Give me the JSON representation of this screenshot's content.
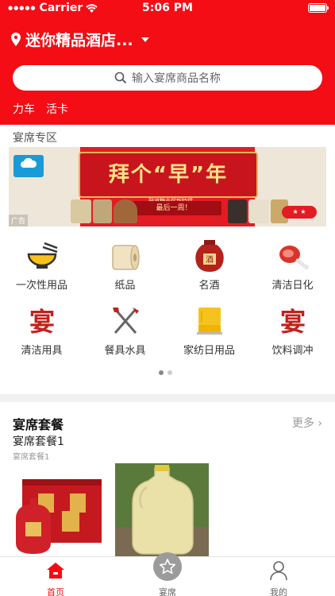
{
  "status_bar": {
    "carrier": "Carrier",
    "time": "5:06 PM"
  },
  "header": {
    "hotel_name": "迷你精品酒店...",
    "search_placeholder": "输入宴席商品名称",
    "tabs": [
      "力车",
      "活卡"
    ],
    "background_color": "#f40d14"
  },
  "banner_section": {
    "title": "宴席专区",
    "banner": {
      "headline": "拜个“早”年",
      "tagline": "最后一周！",
      "promo": "鼓道糖产促新特供",
      "ad_label": "广告"
    }
  },
  "categories": [
    {
      "label": "一次性用品",
      "icon": "bowl-chopsticks-icon"
    },
    {
      "label": "纸品",
      "icon": "toilet-roll-icon"
    },
    {
      "label": "名酒",
      "icon": "liquor-jar-icon"
    },
    {
      "label": "清洁日化",
      "icon": "ham-icon"
    },
    {
      "label": "清洁用具",
      "icon": "banquet-character-icon"
    },
    {
      "label": "餐具水具",
      "icon": "fork-knife-icon"
    },
    {
      "label": "家纺日用品",
      "icon": "towel-icon"
    },
    {
      "label": "饮料调冲",
      "icon": "banquet-character-icon"
    }
  ],
  "pager": {
    "pages": 2,
    "current": 1
  },
  "package_section": {
    "title": "宴席套餐",
    "more": "更多",
    "package_name": "宴席套餐1",
    "package_sub": "宴席套餐1"
  },
  "tabbar": {
    "items": [
      {
        "label": "首页",
        "icon": "home-icon",
        "active": true
      },
      {
        "label": "宴席",
        "icon": "star-icon",
        "active": false
      },
      {
        "label": "我的",
        "icon": "user-icon",
        "active": false
      }
    ]
  }
}
